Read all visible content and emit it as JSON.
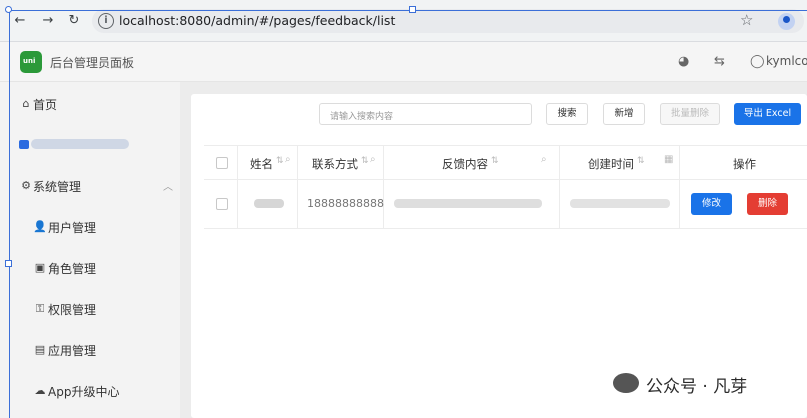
{
  "browser": {
    "url": "localhost:8080/admin/#/pages/feedback/list"
  },
  "app": {
    "title": "后台管理员面板",
    "user": "kymlcod"
  },
  "sidebar": {
    "items": [
      {
        "label": "首页",
        "icon": "home-icon"
      },
      {
        "label": "",
        "icon": "blurred-icon"
      },
      {
        "label": "系统管理",
        "icon": "gear-icon"
      },
      {
        "label": "用户管理",
        "icon": "user-icon"
      },
      {
        "label": "角色管理",
        "icon": "role-icon"
      },
      {
        "label": "权限管理",
        "icon": "permission-icon"
      },
      {
        "label": "应用管理",
        "icon": "app-icon"
      },
      {
        "label": "App升级中心",
        "icon": "cloud-icon"
      }
    ]
  },
  "toolbar": {
    "search_placeholder": "请输入搜索内容",
    "search_label": "搜索",
    "add_label": "新增",
    "batch_delete_label": "批量删除",
    "export_label": "导出 Excel"
  },
  "table": {
    "columns": [
      "姓名",
      "联系方式",
      "反馈内容",
      "创建时间",
      "操作"
    ],
    "rows": [
      {
        "name": "",
        "contact": "18888888888",
        "content": "",
        "created": "",
        "edit_label": "修改",
        "delete_label": "删除"
      }
    ]
  },
  "colors": {
    "primary": "#1a73e8",
    "danger": "#e43d33",
    "logo": "#2b9939"
  },
  "watermark": "公众号 · 凡芽"
}
